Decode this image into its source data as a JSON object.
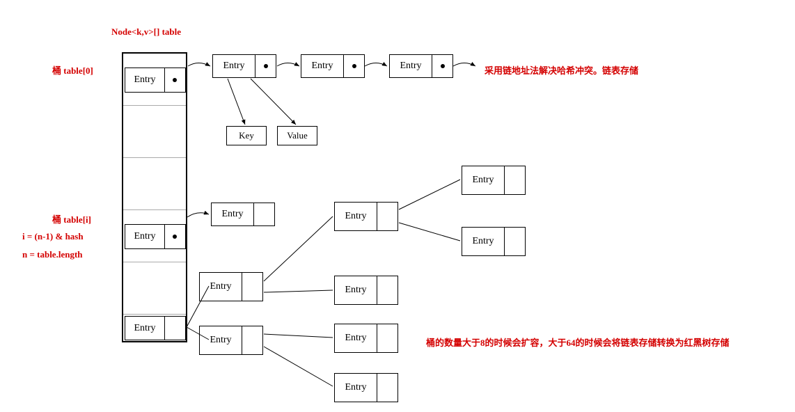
{
  "title": "Node<k,v>[] table",
  "labels": {
    "bucket0": "桶 table[0]",
    "bucketI": "桶 table[i]",
    "formula1": "i = (n-1) & hash",
    "formula2": "n = table.length",
    "chainText": "采用链地址法解决哈希冲突。链表存储",
    "treeText": "桶的数量大于8的时候会扩容，大于64的时候会将链表存储转换为红黑树存储"
  },
  "entryLabel": "Entry",
  "keyLabel": "Key",
  "valueLabel": "Value"
}
